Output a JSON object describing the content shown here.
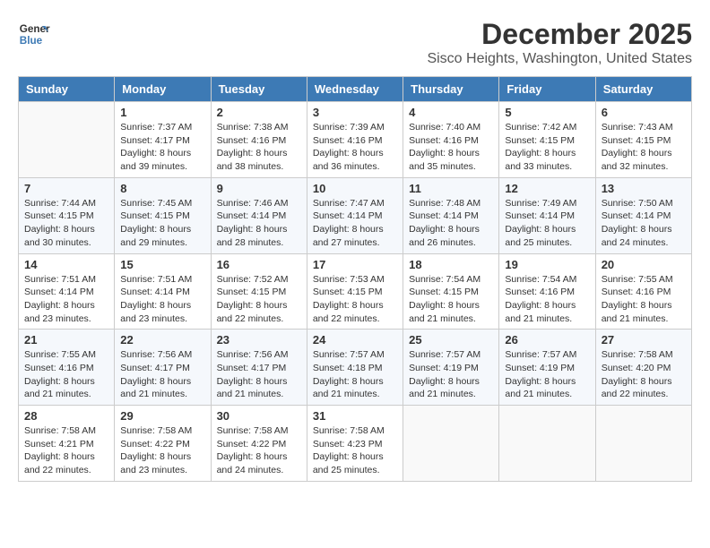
{
  "logo": {
    "line1": "General",
    "line2": "Blue"
  },
  "title": "December 2025",
  "location": "Sisco Heights, Washington, United States",
  "days_of_week": [
    "Sunday",
    "Monday",
    "Tuesday",
    "Wednesday",
    "Thursday",
    "Friday",
    "Saturday"
  ],
  "weeks": [
    [
      {
        "day": "",
        "sunrise": "",
        "sunset": "",
        "daylight": ""
      },
      {
        "day": "1",
        "sunrise": "Sunrise: 7:37 AM",
        "sunset": "Sunset: 4:17 PM",
        "daylight": "Daylight: 8 hours and 39 minutes."
      },
      {
        "day": "2",
        "sunrise": "Sunrise: 7:38 AM",
        "sunset": "Sunset: 4:16 PM",
        "daylight": "Daylight: 8 hours and 38 minutes."
      },
      {
        "day": "3",
        "sunrise": "Sunrise: 7:39 AM",
        "sunset": "Sunset: 4:16 PM",
        "daylight": "Daylight: 8 hours and 36 minutes."
      },
      {
        "day": "4",
        "sunrise": "Sunrise: 7:40 AM",
        "sunset": "Sunset: 4:16 PM",
        "daylight": "Daylight: 8 hours and 35 minutes."
      },
      {
        "day": "5",
        "sunrise": "Sunrise: 7:42 AM",
        "sunset": "Sunset: 4:15 PM",
        "daylight": "Daylight: 8 hours and 33 minutes."
      },
      {
        "day": "6",
        "sunrise": "Sunrise: 7:43 AM",
        "sunset": "Sunset: 4:15 PM",
        "daylight": "Daylight: 8 hours and 32 minutes."
      }
    ],
    [
      {
        "day": "7",
        "sunrise": "Sunrise: 7:44 AM",
        "sunset": "Sunset: 4:15 PM",
        "daylight": "Daylight: 8 hours and 30 minutes."
      },
      {
        "day": "8",
        "sunrise": "Sunrise: 7:45 AM",
        "sunset": "Sunset: 4:15 PM",
        "daylight": "Daylight: 8 hours and 29 minutes."
      },
      {
        "day": "9",
        "sunrise": "Sunrise: 7:46 AM",
        "sunset": "Sunset: 4:14 PM",
        "daylight": "Daylight: 8 hours and 28 minutes."
      },
      {
        "day": "10",
        "sunrise": "Sunrise: 7:47 AM",
        "sunset": "Sunset: 4:14 PM",
        "daylight": "Daylight: 8 hours and 27 minutes."
      },
      {
        "day": "11",
        "sunrise": "Sunrise: 7:48 AM",
        "sunset": "Sunset: 4:14 PM",
        "daylight": "Daylight: 8 hours and 26 minutes."
      },
      {
        "day": "12",
        "sunrise": "Sunrise: 7:49 AM",
        "sunset": "Sunset: 4:14 PM",
        "daylight": "Daylight: 8 hours and 25 minutes."
      },
      {
        "day": "13",
        "sunrise": "Sunrise: 7:50 AM",
        "sunset": "Sunset: 4:14 PM",
        "daylight": "Daylight: 8 hours and 24 minutes."
      }
    ],
    [
      {
        "day": "14",
        "sunrise": "Sunrise: 7:51 AM",
        "sunset": "Sunset: 4:14 PM",
        "daylight": "Daylight: 8 hours and 23 minutes."
      },
      {
        "day": "15",
        "sunrise": "Sunrise: 7:51 AM",
        "sunset": "Sunset: 4:14 PM",
        "daylight": "Daylight: 8 hours and 23 minutes."
      },
      {
        "day": "16",
        "sunrise": "Sunrise: 7:52 AM",
        "sunset": "Sunset: 4:15 PM",
        "daylight": "Daylight: 8 hours and 22 minutes."
      },
      {
        "day": "17",
        "sunrise": "Sunrise: 7:53 AM",
        "sunset": "Sunset: 4:15 PM",
        "daylight": "Daylight: 8 hours and 22 minutes."
      },
      {
        "day": "18",
        "sunrise": "Sunrise: 7:54 AM",
        "sunset": "Sunset: 4:15 PM",
        "daylight": "Daylight: 8 hours and 21 minutes."
      },
      {
        "day": "19",
        "sunrise": "Sunrise: 7:54 AM",
        "sunset": "Sunset: 4:16 PM",
        "daylight": "Daylight: 8 hours and 21 minutes."
      },
      {
        "day": "20",
        "sunrise": "Sunrise: 7:55 AM",
        "sunset": "Sunset: 4:16 PM",
        "daylight": "Daylight: 8 hours and 21 minutes."
      }
    ],
    [
      {
        "day": "21",
        "sunrise": "Sunrise: 7:55 AM",
        "sunset": "Sunset: 4:16 PM",
        "daylight": "Daylight: 8 hours and 21 minutes."
      },
      {
        "day": "22",
        "sunrise": "Sunrise: 7:56 AM",
        "sunset": "Sunset: 4:17 PM",
        "daylight": "Daylight: 8 hours and 21 minutes."
      },
      {
        "day": "23",
        "sunrise": "Sunrise: 7:56 AM",
        "sunset": "Sunset: 4:17 PM",
        "daylight": "Daylight: 8 hours and 21 minutes."
      },
      {
        "day": "24",
        "sunrise": "Sunrise: 7:57 AM",
        "sunset": "Sunset: 4:18 PM",
        "daylight": "Daylight: 8 hours and 21 minutes."
      },
      {
        "day": "25",
        "sunrise": "Sunrise: 7:57 AM",
        "sunset": "Sunset: 4:19 PM",
        "daylight": "Daylight: 8 hours and 21 minutes."
      },
      {
        "day": "26",
        "sunrise": "Sunrise: 7:57 AM",
        "sunset": "Sunset: 4:19 PM",
        "daylight": "Daylight: 8 hours and 21 minutes."
      },
      {
        "day": "27",
        "sunrise": "Sunrise: 7:58 AM",
        "sunset": "Sunset: 4:20 PM",
        "daylight": "Daylight: 8 hours and 22 minutes."
      }
    ],
    [
      {
        "day": "28",
        "sunrise": "Sunrise: 7:58 AM",
        "sunset": "Sunset: 4:21 PM",
        "daylight": "Daylight: 8 hours and 22 minutes."
      },
      {
        "day": "29",
        "sunrise": "Sunrise: 7:58 AM",
        "sunset": "Sunset: 4:22 PM",
        "daylight": "Daylight: 8 hours and 23 minutes."
      },
      {
        "day": "30",
        "sunrise": "Sunrise: 7:58 AM",
        "sunset": "Sunset: 4:22 PM",
        "daylight": "Daylight: 8 hours and 24 minutes."
      },
      {
        "day": "31",
        "sunrise": "Sunrise: 7:58 AM",
        "sunset": "Sunset: 4:23 PM",
        "daylight": "Daylight: 8 hours and 25 minutes."
      },
      {
        "day": "",
        "sunrise": "",
        "sunset": "",
        "daylight": ""
      },
      {
        "day": "",
        "sunrise": "",
        "sunset": "",
        "daylight": ""
      },
      {
        "day": "",
        "sunrise": "",
        "sunset": "",
        "daylight": ""
      }
    ]
  ]
}
